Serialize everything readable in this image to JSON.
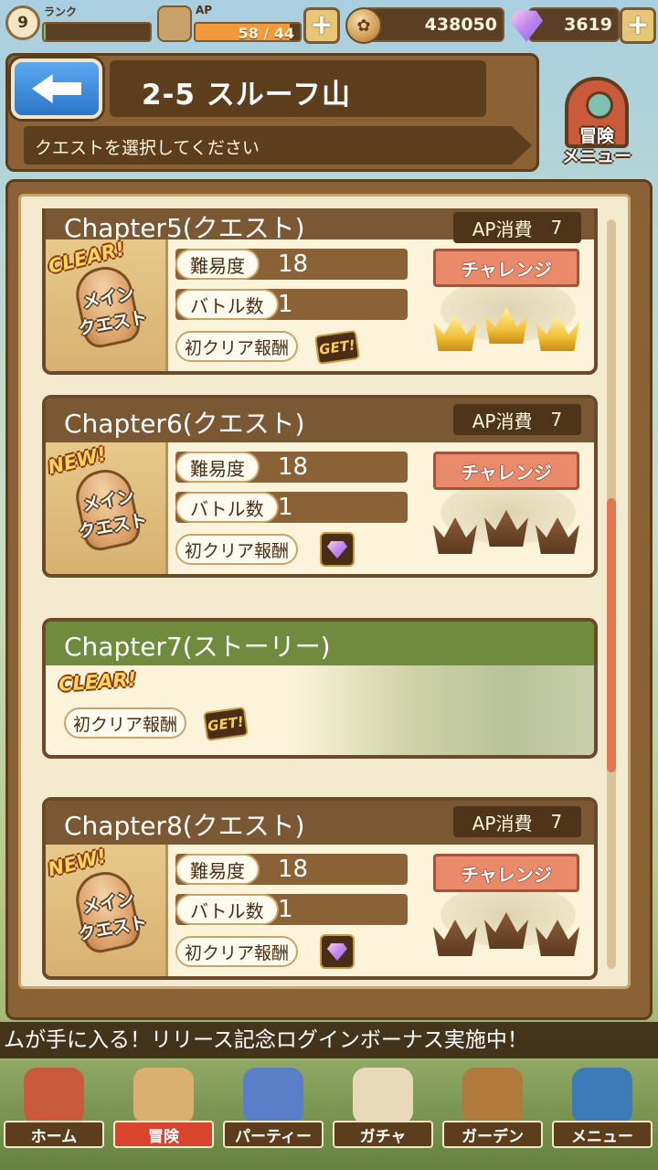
{
  "status": {
    "rank_level": "9",
    "rank_label": "ランク",
    "rank_progress": 0.02,
    "ap_label": "AP",
    "ap_text": "58 / 44",
    "ap_fill": 0.9,
    "coins": "438050",
    "gems": "3619",
    "plus": "+"
  },
  "header": {
    "stage_title": "2-5 スルーフ山",
    "instruction": "クエストを選択してください",
    "adventure_menu_label": "冒険\nメニュー"
  },
  "quests": [
    {
      "title": "Chapter5(クエスト)",
      "ap_label": "AP消費",
      "ap_cost": "7",
      "stamp": "CLEAR!",
      "type_label": "メイン\nクエスト",
      "difficulty_label": "難易度",
      "difficulty": "18",
      "battles_label": "バトル数",
      "battles": "1",
      "reward_label": "初クリア報酬",
      "reward": "GET!",
      "challenge_label": "チャレンジ",
      "crowns_earned": 3
    },
    {
      "title": "Chapter6(クエスト)",
      "ap_label": "AP消費",
      "ap_cost": "7",
      "stamp": "NEW!",
      "type_label": "メイン\nクエスト",
      "difficulty_label": "難易度",
      "difficulty": "18",
      "battles_label": "バトル数",
      "battles": "1",
      "reward_label": "初クリア報酬",
      "reward": "gem-icon",
      "challenge_label": "チャレンジ",
      "crowns_earned": 0
    },
    {
      "title": "Chapter8(クエスト)",
      "ap_label": "AP消費",
      "ap_cost": "7",
      "stamp": "NEW!",
      "type_label": "メイン\nクエスト",
      "difficulty_label": "難易度",
      "difficulty": "18",
      "battles_label": "バトル数",
      "battles": "1",
      "reward_label": "初クリア報酬",
      "reward": "gem-icon",
      "challenge_label": "チャレンジ",
      "crowns_earned": 0
    }
  ],
  "story": {
    "title": "Chapter7(ストーリー)",
    "stamp": "CLEAR!",
    "reward_label": "初クリア報酬",
    "reward": "GET!"
  },
  "ticker": "ムが手に入る！リリース記念ログインボーナス実施中！",
  "nav": [
    {
      "label": "ホーム",
      "icon": "house-icon",
      "color": "#c95a3c"
    },
    {
      "label": "冒険",
      "icon": "compass-map-icon",
      "color": "#d9b070",
      "active": true
    },
    {
      "label": "パーティー",
      "icon": "chess-pieces-icon",
      "color": "#5a7ec8"
    },
    {
      "label": "ガチャ",
      "icon": "gacha-card-icon",
      "color": "#e8d9b8"
    },
    {
      "label": "ガーデン",
      "icon": "basket-icon",
      "color": "#b07a3c"
    },
    {
      "label": "メニュー",
      "icon": "book-icon",
      "color": "#3c7ab8"
    }
  ]
}
